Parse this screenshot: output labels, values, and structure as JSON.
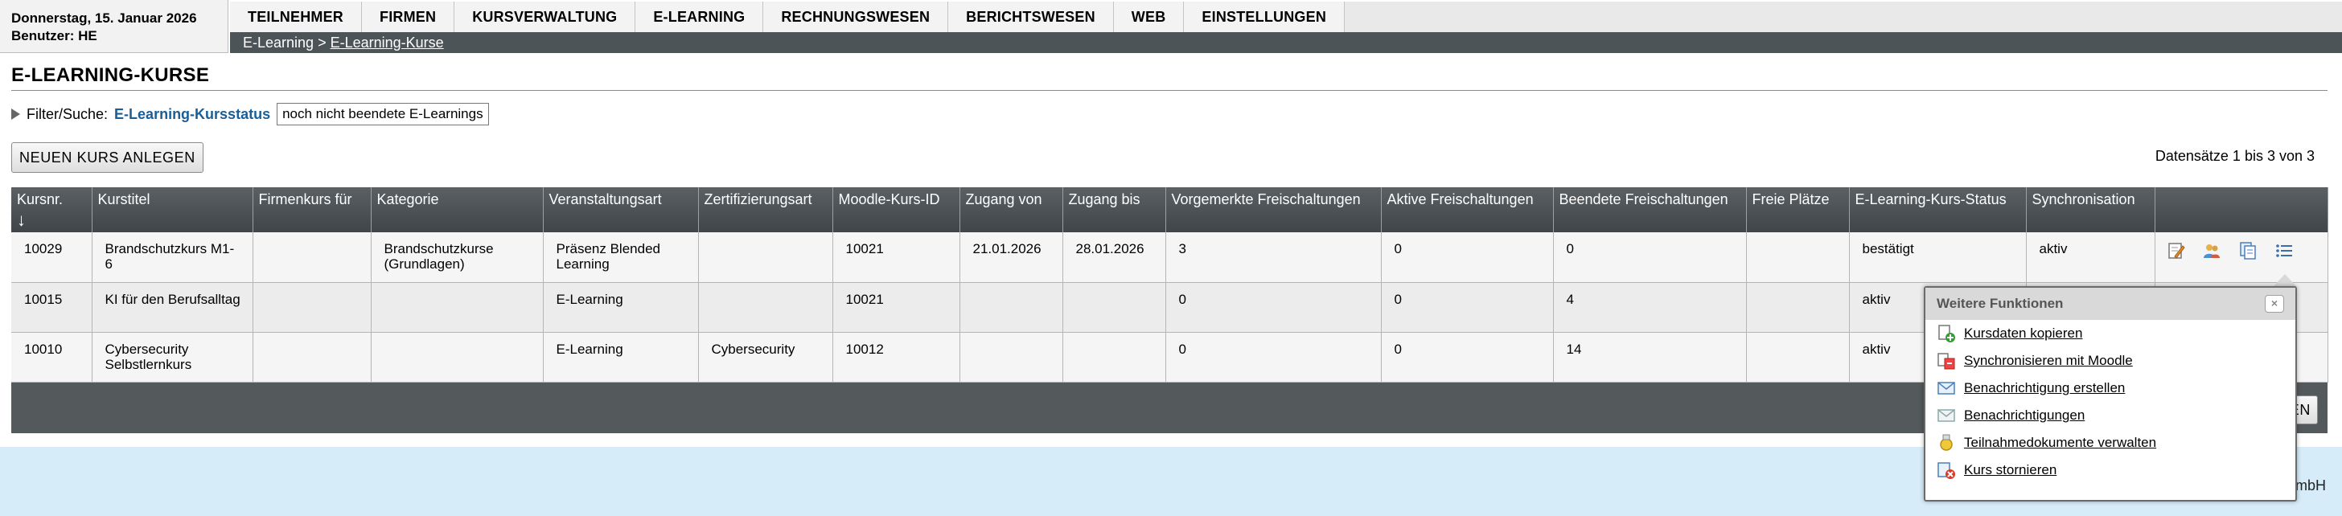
{
  "header": {
    "date": "Donnerstag, 15. Januar 2026",
    "user": "Benutzer: HE"
  },
  "nav": {
    "items": [
      "TEILNEHMER",
      "FIRMEN",
      "KURSVERWALTUNG",
      "E-LEARNING",
      "RECHNUNGSWESEN",
      "BERICHTSWESEN",
      "WEB",
      "EINSTELLUNGEN"
    ]
  },
  "breadcrumb": {
    "parent": "E-Learning",
    "separator": ">",
    "current": "E-Learning-Kurse"
  },
  "page": {
    "title": "E-LEARNING-KURSE"
  },
  "filter": {
    "label": "Filter/Suche:",
    "field": "E-Learning-Kursstatus",
    "value": "noch nicht beendete E-Learnings"
  },
  "actions": {
    "new_course": "NEUEN KURS ANLEGEN",
    "records": "Datensätze 1 bis 3 von 3",
    "bottom_button_partial": "EN"
  },
  "table": {
    "columns": [
      "Kursnr.",
      "Kurstitel",
      "Firmenkurs für",
      "Kategorie",
      "Veranstaltungsart",
      "Zertifizierungsart",
      "Moodle-Kurs-ID",
      "Zugang von",
      "Zugang bis",
      "Vorgemerkte Freischaltungen",
      "Aktive Freischaltungen",
      "Beendete Freischaltungen",
      "Freie Plätze",
      "E-Learning-Kurs-Status",
      "Synchronisation",
      ""
    ],
    "sort_indicator": "↓",
    "rows": [
      [
        "10029",
        "Brandschutzkurs M1-6",
        "",
        "Brandschutzkurse (Grundlagen)",
        "Präsenz Blended Learning",
        "",
        "10021",
        "21.01.2026",
        "28.01.2026",
        "3",
        "0",
        "0",
        "",
        "bestätigt",
        "aktiv"
      ],
      [
        "10015",
        "KI für den Berufsalltag",
        "",
        "",
        "E-Learning",
        "",
        "10021",
        "",
        "",
        "0",
        "0",
        "4",
        "",
        "aktiv",
        ""
      ],
      [
        "10010",
        "Cybersecurity Selbstlernkurs",
        "",
        "",
        "E-Learning",
        "Cybersecurity",
        "10012",
        "",
        "",
        "0",
        "0",
        "14",
        "",
        "aktiv",
        ""
      ]
    ],
    "row_icons": [
      "edit-icon",
      "users-icon",
      "copy-icon",
      "list-icon"
    ]
  },
  "popup": {
    "title": "Weitere Funktionen",
    "close": "×",
    "items": [
      {
        "label": "Kursdaten kopieren",
        "icon": "copy-add-icon"
      },
      {
        "label": "Synchronisieren mit Moodle",
        "icon": "sync-icon"
      },
      {
        "label": "Benachrichtigung erstellen",
        "icon": "mail-add-icon"
      },
      {
        "label": "Benachrichtigungen",
        "icon": "mail-icon"
      },
      {
        "label": "Teilnahmedokumente verwalten",
        "icon": "document-award-icon"
      },
      {
        "label": "Kurs stornieren",
        "icon": "cancel-course-icon"
      }
    ]
  },
  "footer": {
    "text_partial": "mbH"
  }
}
